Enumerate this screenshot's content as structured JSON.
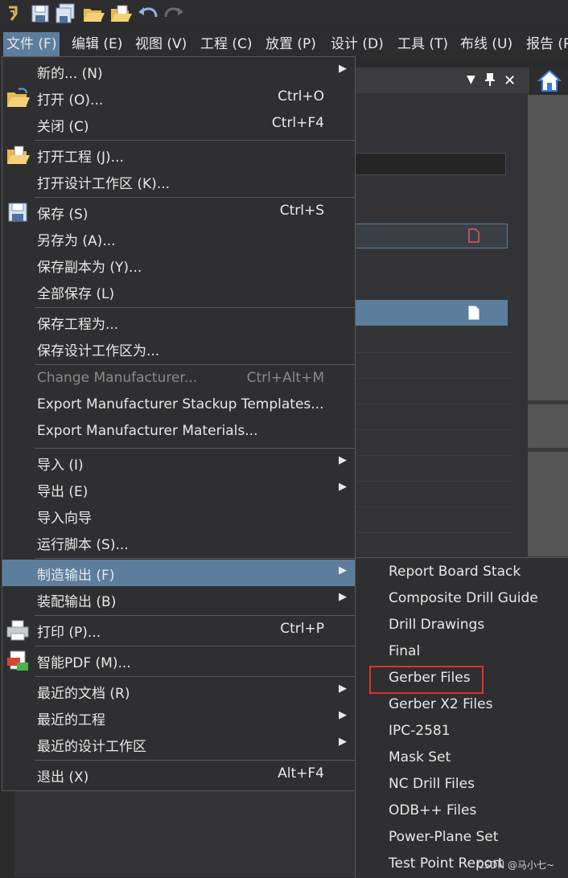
{
  "toolbar": {
    "icons": [
      "app-logo-icon",
      "save-icon",
      "save-all-icon",
      "open-icon",
      "open-project-icon",
      "undo-icon",
      "redo-icon"
    ]
  },
  "menubar": {
    "items": [
      {
        "label": "文件 (F)",
        "name": "menu-file",
        "active": true
      },
      {
        "label": "编辑 (E)",
        "name": "menu-edit"
      },
      {
        "label": "视图 (V)",
        "name": "menu-view"
      },
      {
        "label": "工程 (C)",
        "name": "menu-project"
      },
      {
        "label": "放置 (P)",
        "name": "menu-place"
      },
      {
        "label": "设计 (D)",
        "name": "menu-design"
      },
      {
        "label": "工具 (T)",
        "name": "menu-tools"
      },
      {
        "label": "布线 (U)",
        "name": "menu-route"
      },
      {
        "label": "报告 (R",
        "name": "menu-reports"
      }
    ]
  },
  "file_menu": {
    "items": [
      {
        "label": "新的... (N)",
        "submenu": true
      },
      {
        "label": "打开 (O)...",
        "shortcut": "Ctrl+O",
        "icon": "open-folder-icon"
      },
      {
        "label": "关闭 (C)",
        "shortcut": "Ctrl+F4"
      },
      {
        "label": "打开工程 (J)...",
        "icon": "open-project-icon"
      },
      {
        "label": "打开设计工作区 (K)..."
      },
      {
        "label": "保存 (S)",
        "shortcut": "Ctrl+S",
        "icon": "save-icon"
      },
      {
        "label": "另存为 (A)..."
      },
      {
        "label": "保存副本为 (Y)..."
      },
      {
        "label": "全部保存 (L)"
      },
      {
        "label": "保存工程为..."
      },
      {
        "label": "保存设计工作区为..."
      },
      {
        "label": "Change Manufacturer...",
        "shortcut": "Ctrl+Alt+M",
        "disabled": true
      },
      {
        "label": "Export Manufacturer Stackup Templates..."
      },
      {
        "label": "Export Manufacturer Materials..."
      },
      {
        "label": "导入 (I)",
        "submenu": true
      },
      {
        "label": "导出 (E)",
        "submenu": true
      },
      {
        "label": "导入向导"
      },
      {
        "label": "运行脚本 (S)..."
      },
      {
        "label": "制造输出 (F)",
        "submenu": true,
        "active": true
      },
      {
        "label": "装配输出 (B)",
        "submenu": true
      },
      {
        "label": "打印 (P)...",
        "shortcut": "Ctrl+P",
        "icon": "print-icon"
      },
      {
        "label": "智能PDF (M)...",
        "icon": "smart-pdf-icon"
      },
      {
        "label": "最近的文档 (R)",
        "submenu": true
      },
      {
        "label": "最近的工程",
        "submenu": true
      },
      {
        "label": "最近的设计工作区",
        "submenu": true
      },
      {
        "label": "退出 (X)",
        "shortcut": "Alt+F4"
      }
    ]
  },
  "fab_submenu": {
    "items": [
      "Report Board Stack",
      "Composite Drill Guide",
      "Drill Drawings",
      "Final",
      "Gerber Files",
      "Gerber X2 Files",
      "IPC-2581",
      "Mask Set",
      "NC Drill Files",
      "ODB++ Files",
      "Power-Plane Set",
      "Test Point Report"
    ],
    "highlighted": "Gerber Files"
  },
  "watermark": "CSDN @马小七~",
  "colors": {
    "highlight": "#5c7d9c",
    "callout": "#e03030"
  }
}
